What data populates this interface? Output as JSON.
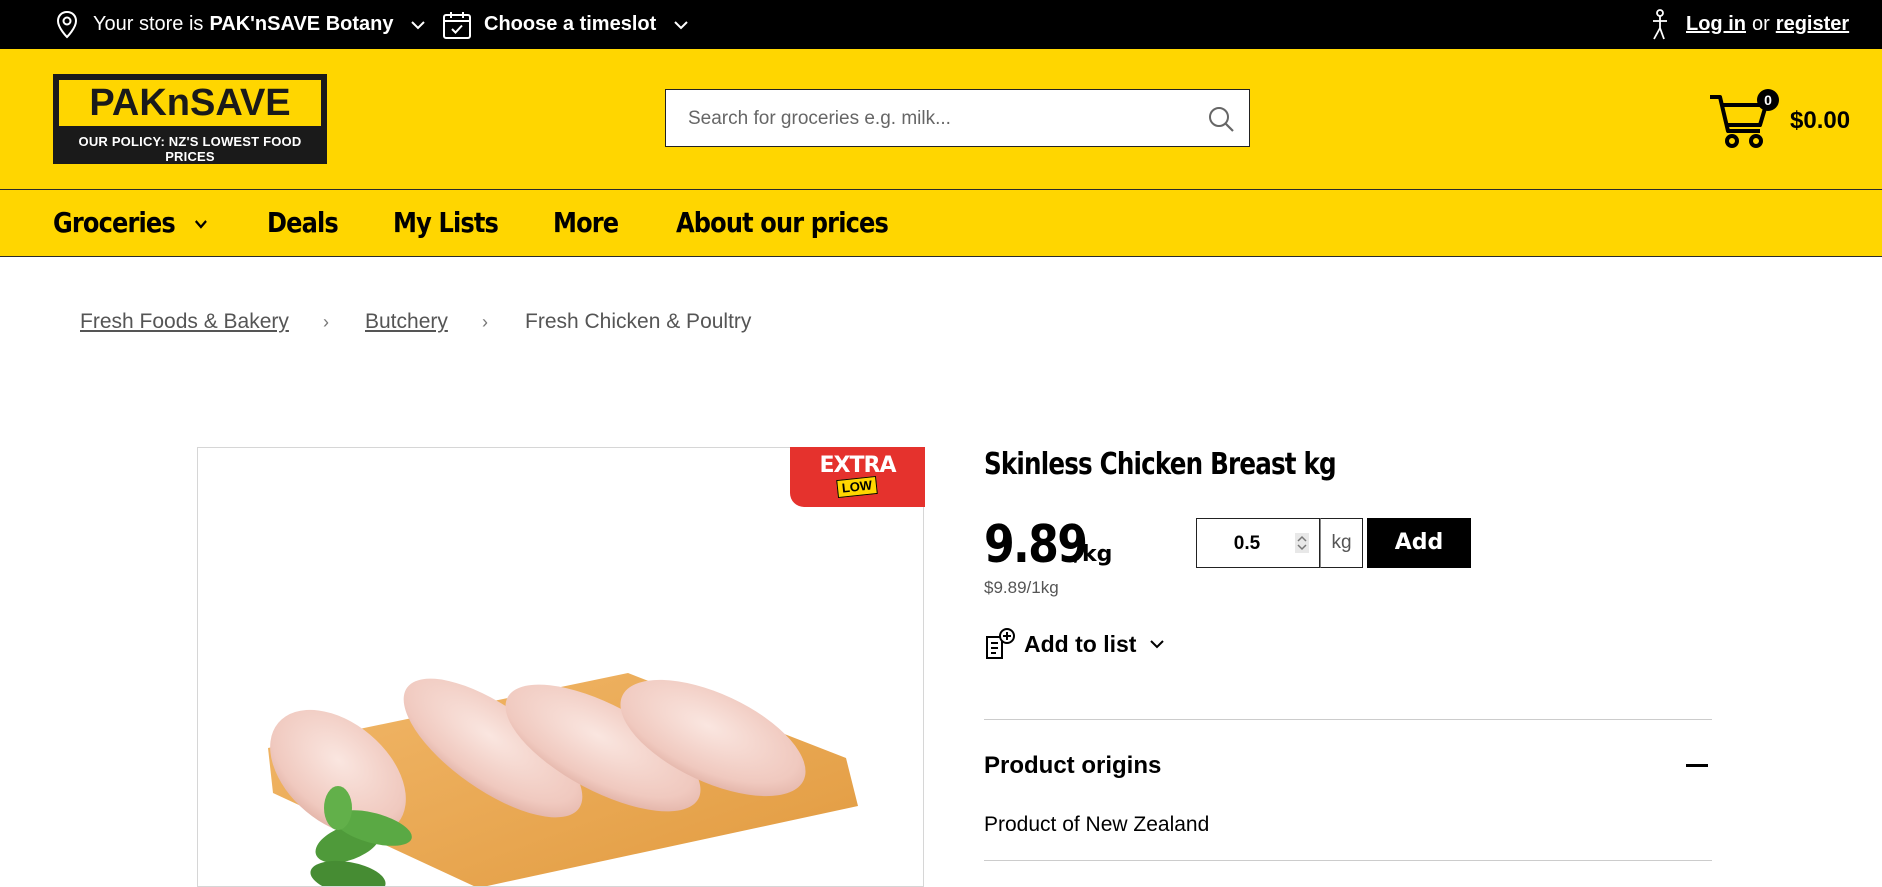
{
  "topbar": {
    "store_prefix": "Your store is",
    "store_name": "PAK'nSAVE Botany",
    "timeslot_label": "Choose a timeslot",
    "login_label": "Log in",
    "or_label": "or",
    "register_label": "register"
  },
  "header": {
    "logo_text": "PAKnSAVE",
    "logo_tagline": "OUR POLICY: NZ'S LOWEST FOOD PRICES",
    "search_placeholder": "Search for groceries e.g. milk...",
    "cart_count": "0",
    "cart_total": "$0.00"
  },
  "nav": {
    "items": [
      "Groceries",
      "Deals",
      "My Lists",
      "More",
      "About our prices"
    ]
  },
  "breadcrumb": {
    "items": [
      "Fresh Foods & Bakery",
      "Butchery",
      "Fresh Chicken & Poultry"
    ]
  },
  "product": {
    "badge_top": "EXTRA",
    "badge_bottom": "LOW",
    "title": "Skinless Chicken Breast kg",
    "price": "9.89",
    "price_unit": "/kg",
    "unit_price": "$9.89/1kg",
    "quantity": "0.5",
    "quantity_unit": "kg",
    "add_label": "Add",
    "add_to_list_label": "Add to list",
    "origins_title": "Product origins",
    "origins_text": "Product of New Zealand"
  },
  "colors": {
    "brand_yellow": "#FFD600",
    "badge_red": "#E5322D",
    "topbar_black": "#000000"
  }
}
